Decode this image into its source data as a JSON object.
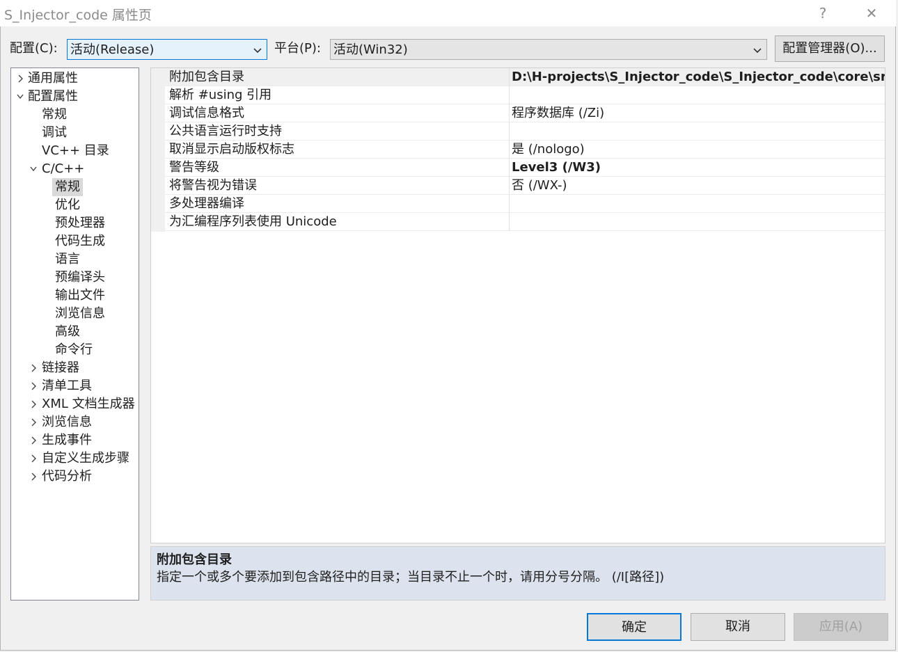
{
  "window": {
    "title": "S_Injector_code 属性页",
    "help_glyph": "?",
    "close_glyph": "✕"
  },
  "config": {
    "label": "配置(C):",
    "value": "活动(Release)"
  },
  "platform": {
    "label": "平台(P):",
    "value": "活动(Win32)"
  },
  "config_manager_label": "配置管理器(O)...",
  "tree": [
    {
      "label": "通用属性",
      "arrow": "right"
    },
    {
      "label": "配置属性",
      "arrow": "down"
    },
    {
      "label": "常规"
    },
    {
      "label": "调试"
    },
    {
      "label": "VC++ 目录"
    },
    {
      "label": "C/C++",
      "arrow": "down"
    },
    {
      "label": "常规",
      "selected": true
    },
    {
      "label": "优化"
    },
    {
      "label": "预处理器"
    },
    {
      "label": "代码生成"
    },
    {
      "label": "语言"
    },
    {
      "label": "预编译头"
    },
    {
      "label": "输出文件"
    },
    {
      "label": "浏览信息"
    },
    {
      "label": "高级"
    },
    {
      "label": "命令行"
    },
    {
      "label": "链接器",
      "arrow": "right"
    },
    {
      "label": "清单工具",
      "arrow": "right"
    },
    {
      "label": "XML 文档生成器",
      "arrow": "right"
    },
    {
      "label": "浏览信息",
      "arrow": "right"
    },
    {
      "label": "生成事件",
      "arrow": "right"
    },
    {
      "label": "自定义生成步骤",
      "arrow": "right"
    },
    {
      "label": "代码分析",
      "arrow": "right"
    }
  ],
  "properties": [
    {
      "name": "附加包含目录",
      "value": "D:\\H-projects\\S_Injector_code\\S_Injector_code\\core\\src;%(A",
      "bold": true,
      "selected": true
    },
    {
      "name": "解析 #using 引用",
      "value": ""
    },
    {
      "name": "调试信息格式",
      "value": "程序数据库 (/Zi)"
    },
    {
      "name": "公共语言运行时支持",
      "value": ""
    },
    {
      "name": "取消显示启动版权标志",
      "value": "是 (/nologo)"
    },
    {
      "name": "警告等级",
      "value": "Level3 (/W3)",
      "bold": true
    },
    {
      "name": "将警告视为错误",
      "value": "否 (/WX-)"
    },
    {
      "name": "多处理器编译",
      "value": ""
    },
    {
      "name": "为汇编程序列表使用 Unicode",
      "value": ""
    }
  ],
  "description": {
    "title": "附加包含目录",
    "text": "指定一个或多个要添加到包含路径中的目录；当目录不止一个时，请用分号分隔。    (/I[路径])"
  },
  "buttons": {
    "ok": "确定",
    "cancel": "取消",
    "apply": "应用(A)"
  },
  "colors": {
    "accent": "#0078d7",
    "description_bg": "#dde3ee",
    "disabled_text": "#a0a0a0"
  }
}
